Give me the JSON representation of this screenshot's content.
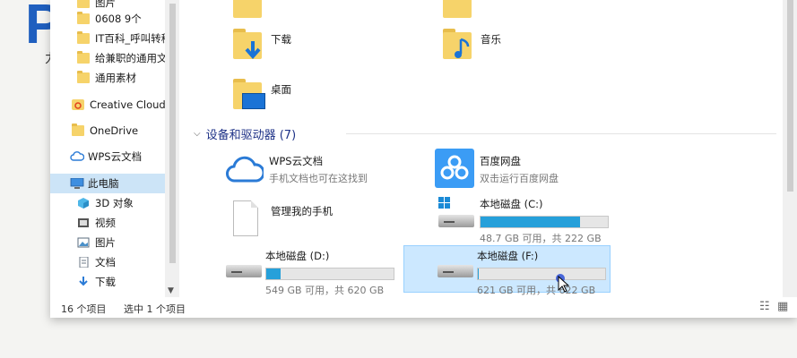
{
  "background": {
    "letter": "P",
    "char": "力"
  },
  "sidebar": {
    "items": [
      {
        "label": "图片",
        "icon": "folder-icon"
      },
      {
        "label": "0608 9个",
        "icon": "folder-icon"
      },
      {
        "label": "IT百科_呼叫转移",
        "icon": "folder-icon"
      },
      {
        "label": "给兼职的通用文件",
        "icon": "folder-icon"
      },
      {
        "label": "通用素材",
        "icon": "folder-icon"
      },
      {
        "label": "Creative Cloud F",
        "icon": "creative-cloud-icon"
      },
      {
        "label": "OneDrive",
        "icon": "folder-icon"
      },
      {
        "label": "WPS云文档",
        "icon": "cloud-icon"
      },
      {
        "label": "此电脑",
        "icon": "computer-icon"
      },
      {
        "label": "3D 对象",
        "icon": "3d-objects-icon"
      },
      {
        "label": "视频",
        "icon": "video-icon"
      },
      {
        "label": "图片",
        "icon": "pictures-icon"
      },
      {
        "label": "文档",
        "icon": "documents-icon"
      },
      {
        "label": "下载",
        "icon": "download-icon"
      }
    ]
  },
  "folders": [
    {
      "label": "下载"
    },
    {
      "label": "音乐"
    },
    {
      "label": "桌面"
    }
  ],
  "section": {
    "title": "设备和驱动器 (7)"
  },
  "devices": {
    "wps": {
      "name": "WPS云文档",
      "desc": "手机文档也可在这找到"
    },
    "baidu": {
      "name": "百度网盘",
      "desc": "双击运行百度网盘"
    },
    "phone": {
      "name": "管理我的手机"
    },
    "c": {
      "name": "本地磁盘 (C:)",
      "info": "48.7 GB 可用，共 222 GB",
      "used_fraction": 0.78
    },
    "d": {
      "name": "本地磁盘 (D:)",
      "info": "549 GB 可用，共 620 GB",
      "used_fraction": 0.11
    },
    "f": {
      "name": "本地磁盘 (F:)",
      "info": "621 GB 可用，共 622 GB",
      "used_fraction": 0.002
    }
  },
  "status": {
    "count": "16 个项目",
    "selected": "选中 1 个项目"
  },
  "colors": {
    "accent": "#26a0da",
    "selection": "#cce8ff",
    "section": "#1e3287"
  }
}
